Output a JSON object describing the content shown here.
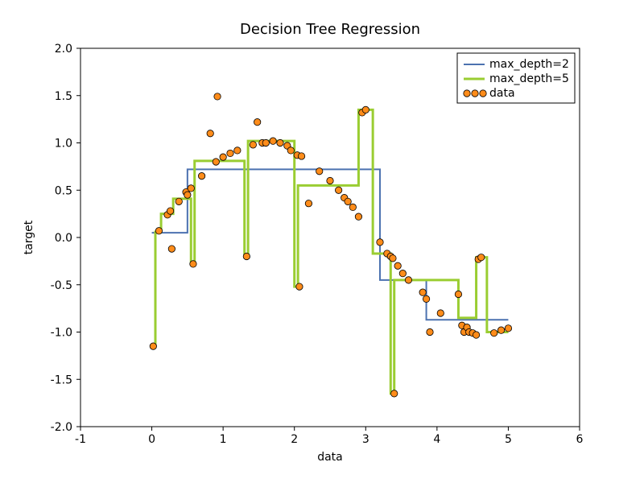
{
  "chart_data": {
    "type": "scatter",
    "title": "Decision Tree Regression",
    "xlabel": "data",
    "ylabel": "target",
    "xlim": [
      -1,
      6
    ],
    "ylim": [
      -2,
      2
    ],
    "xticks": [
      -1,
      0,
      1,
      2,
      3,
      4,
      5,
      6
    ],
    "yticks": [
      -2.0,
      -1.5,
      -1.0,
      -0.5,
      0.0,
      0.5,
      1.0,
      1.5,
      2.0
    ],
    "series": [
      {
        "name": "max_depth=2",
        "type": "line-step",
        "color": "#4c72b0",
        "segments": [
          {
            "x0": 0.0,
            "x1": 0.5,
            "y": 0.05
          },
          {
            "x0": 0.5,
            "x1": 3.2,
            "y": 0.72
          },
          {
            "x0": 3.2,
            "x1": 3.85,
            "y": -0.45
          },
          {
            "x0": 3.85,
            "x1": 5.0,
            "y": -0.87
          }
        ]
      },
      {
        "name": "max_depth=5",
        "type": "line-step",
        "color": "#9acd32",
        "segments": [
          {
            "x0": 0.0,
            "x1": 0.05,
            "y": -1.15
          },
          {
            "x0": 0.05,
            "x1": 0.13,
            "y": 0.06
          },
          {
            "x0": 0.13,
            "x1": 0.3,
            "y": 0.25
          },
          {
            "x0": 0.3,
            "x1": 0.55,
            "y": 0.41
          },
          {
            "x0": 0.55,
            "x1": 0.6,
            "y": -0.28
          },
          {
            "x0": 0.6,
            "x1": 1.3,
            "y": 0.81
          },
          {
            "x0": 1.3,
            "x1": 1.35,
            "y": -0.2
          },
          {
            "x0": 1.35,
            "x1": 2.0,
            "y": 1.02
          },
          {
            "x0": 2.0,
            "x1": 2.05,
            "y": -0.52
          },
          {
            "x0": 2.05,
            "x1": 2.9,
            "y": 0.55
          },
          {
            "x0": 2.9,
            "x1": 3.1,
            "y": 1.35
          },
          {
            "x0": 3.1,
            "x1": 3.35,
            "y": -0.17
          },
          {
            "x0": 3.35,
            "x1": 3.4,
            "y": -1.65
          },
          {
            "x0": 3.4,
            "x1": 4.3,
            "y": -0.45
          },
          {
            "x0": 4.3,
            "x1": 4.55,
            "y": -0.85
          },
          {
            "x0": 4.55,
            "x1": 4.7,
            "y": -0.21
          },
          {
            "x0": 4.7,
            "x1": 5.0,
            "y": -1.0
          }
        ]
      },
      {
        "name": "data",
        "type": "scatter",
        "color": "#ff8c1a",
        "points": [
          {
            "x": 0.02,
            "y": -1.15
          },
          {
            "x": 0.1,
            "y": 0.07
          },
          {
            "x": 0.22,
            "y": 0.24
          },
          {
            "x": 0.26,
            "y": 0.28
          },
          {
            "x": 0.28,
            "y": -0.12
          },
          {
            "x": 0.38,
            "y": 0.38
          },
          {
            "x": 0.48,
            "y": 0.48
          },
          {
            "x": 0.5,
            "y": 0.45
          },
          {
            "x": 0.55,
            "y": 0.52
          },
          {
            "x": 0.58,
            "y": -0.28
          },
          {
            "x": 0.7,
            "y": 0.65
          },
          {
            "x": 0.82,
            "y": 1.1
          },
          {
            "x": 0.9,
            "y": 0.8
          },
          {
            "x": 0.92,
            "y": 1.49
          },
          {
            "x": 1.0,
            "y": 0.85
          },
          {
            "x": 1.1,
            "y": 0.89
          },
          {
            "x": 1.2,
            "y": 0.92
          },
          {
            "x": 1.33,
            "y": -0.2
          },
          {
            "x": 1.42,
            "y": 0.98
          },
          {
            "x": 1.48,
            "y": 1.22
          },
          {
            "x": 1.55,
            "y": 1.0
          },
          {
            "x": 1.6,
            "y": 1.0
          },
          {
            "x": 1.7,
            "y": 1.02
          },
          {
            "x": 1.8,
            "y": 1.0
          },
          {
            "x": 1.9,
            "y": 0.97
          },
          {
            "x": 1.95,
            "y": 0.92
          },
          {
            "x": 2.04,
            "y": 0.87
          },
          {
            "x": 2.07,
            "y": -0.52
          },
          {
            "x": 2.1,
            "y": 0.86
          },
          {
            "x": 2.2,
            "y": 0.36
          },
          {
            "x": 2.35,
            "y": 0.7
          },
          {
            "x": 2.5,
            "y": 0.6
          },
          {
            "x": 2.62,
            "y": 0.5
          },
          {
            "x": 2.7,
            "y": 0.42
          },
          {
            "x": 2.75,
            "y": 0.38
          },
          {
            "x": 2.82,
            "y": 0.32
          },
          {
            "x": 2.9,
            "y": 0.22
          },
          {
            "x": 2.95,
            "y": 1.32
          },
          {
            "x": 3.0,
            "y": 1.35
          },
          {
            "x": 3.2,
            "y": -0.05
          },
          {
            "x": 3.3,
            "y": -0.17
          },
          {
            "x": 3.35,
            "y": -0.2
          },
          {
            "x": 3.38,
            "y": -0.22
          },
          {
            "x": 3.4,
            "y": -1.65
          },
          {
            "x": 3.45,
            "y": -0.3
          },
          {
            "x": 3.52,
            "y": -0.38
          },
          {
            "x": 3.6,
            "y": -0.45
          },
          {
            "x": 3.8,
            "y": -0.58
          },
          {
            "x": 3.85,
            "y": -0.65
          },
          {
            "x": 3.9,
            "y": -1.0
          },
          {
            "x": 4.05,
            "y": -0.8
          },
          {
            "x": 4.3,
            "y": -0.6
          },
          {
            "x": 4.35,
            "y": -0.93
          },
          {
            "x": 4.38,
            "y": -1.0
          },
          {
            "x": 4.42,
            "y": -0.95
          },
          {
            "x": 4.45,
            "y": -1.0
          },
          {
            "x": 4.5,
            "y": -1.01
          },
          {
            "x": 4.55,
            "y": -1.03
          },
          {
            "x": 4.58,
            "y": -0.23
          },
          {
            "x": 4.62,
            "y": -0.21
          },
          {
            "x": 4.8,
            "y": -1.01
          },
          {
            "x": 4.9,
            "y": -0.98
          },
          {
            "x": 5.0,
            "y": -0.96
          }
        ]
      }
    ],
    "legend": {
      "position": "upper-right",
      "items": [
        "max_depth=2",
        "max_depth=5",
        "data"
      ]
    }
  }
}
